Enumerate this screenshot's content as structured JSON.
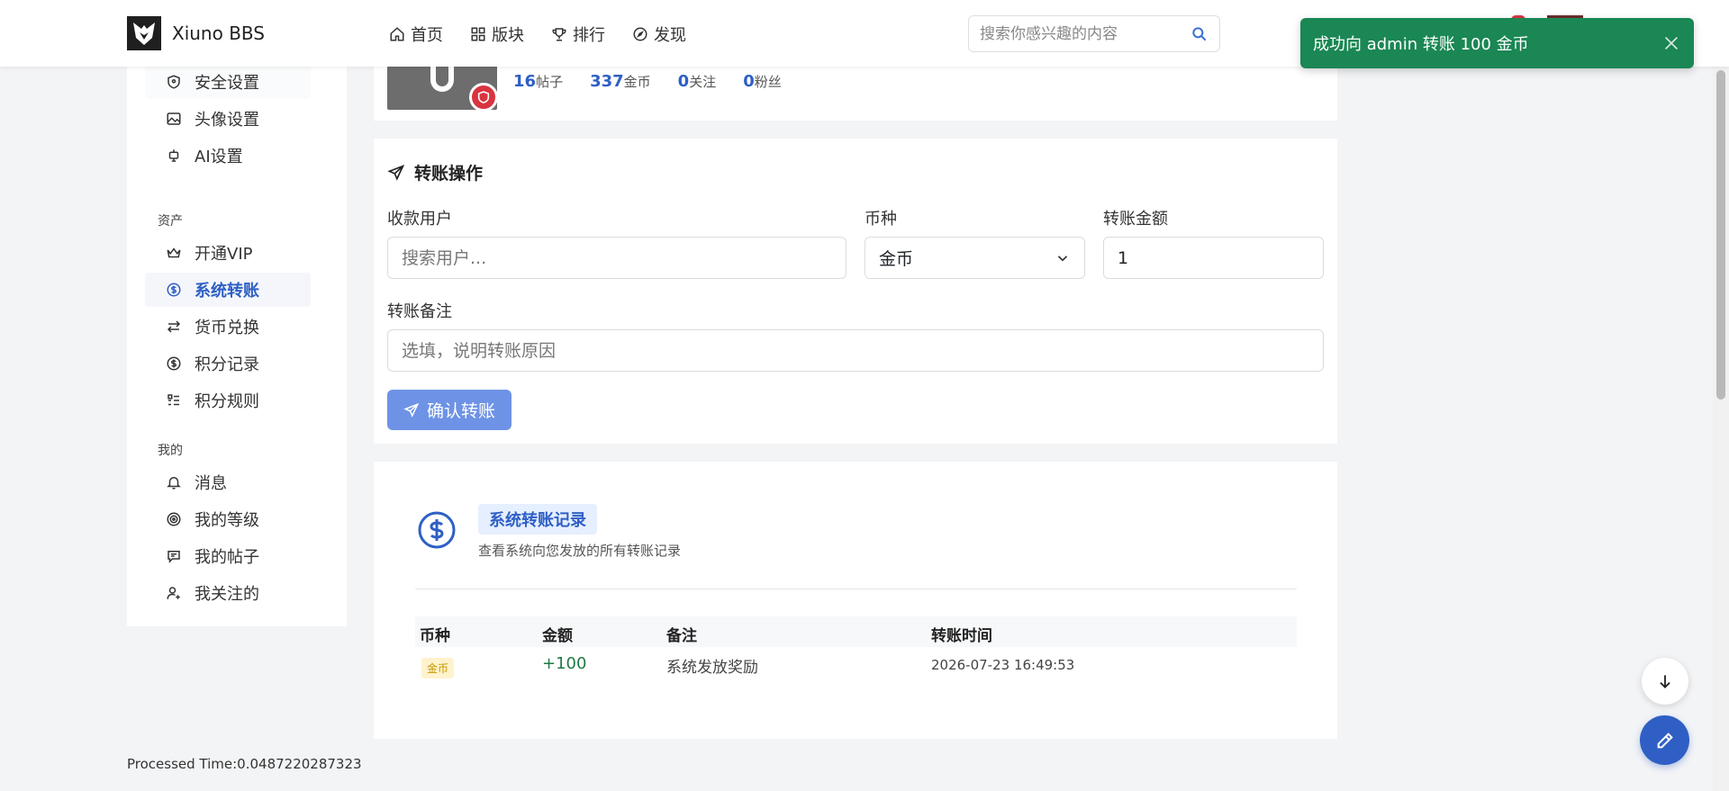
{
  "header": {
    "brand": "Xiuno BBS",
    "nav": [
      {
        "label": "首页",
        "icon": "home-icon"
      },
      {
        "label": "版块",
        "icon": "grid-icon"
      },
      {
        "label": "排行",
        "icon": "trophy-icon"
      },
      {
        "label": "发现",
        "icon": "compass-icon"
      }
    ],
    "search_placeholder": "搜索你感兴趣的内容"
  },
  "toast": {
    "message": "成功向 admin 转账 100 金币",
    "color": "#1a8754"
  },
  "sidebar": {
    "items_top": [
      {
        "label": "安全设置",
        "icon": "shield-icon"
      },
      {
        "label": "头像设置",
        "icon": "image-icon"
      },
      {
        "label": "AI设置",
        "icon": "robot-icon"
      }
    ],
    "section_assets": "资产",
    "items_assets": [
      {
        "label": "开通VIP",
        "icon": "crown-icon"
      },
      {
        "label": "系统转账",
        "icon": "dollar-icon",
        "active": true
      },
      {
        "label": "货币兑换",
        "icon": "exchange-icon"
      },
      {
        "label": "积分记录",
        "icon": "dollar-icon"
      },
      {
        "label": "积分规则",
        "icon": "list-icon"
      }
    ],
    "section_mine": "我的",
    "items_mine": [
      {
        "label": "消息",
        "icon": "bell-icon"
      },
      {
        "label": "我的等级",
        "icon": "target-icon"
      },
      {
        "label": "我的帖子",
        "icon": "message-icon"
      },
      {
        "label": "我关注的",
        "icon": "user-plus-icon"
      }
    ]
  },
  "profile": {
    "stats": [
      {
        "num": "16",
        "label": "帖子"
      },
      {
        "num": "337",
        "label": "金币"
      },
      {
        "num": "0",
        "label": "关注"
      },
      {
        "num": "0",
        "label": "粉丝"
      }
    ]
  },
  "transfer": {
    "title": "转账操作",
    "recipient_label": "收款用户",
    "recipient_placeholder": "搜索用户...",
    "currency_label": "币种",
    "currency_value": "金币",
    "amount_label": "转账金额",
    "amount_value": "1",
    "note_label": "转账备注",
    "note_placeholder": "选填，说明转账原因",
    "confirm_label": "确认转账"
  },
  "records": {
    "title": "系统转账记录",
    "subtitle": "查看系统向您发放的所有转账记录",
    "columns": [
      "币种",
      "金额",
      "备注",
      "转账时间"
    ],
    "rows": [
      {
        "currency": "金币",
        "amount": "+100",
        "note": "系统发放奖励",
        "time": "2026-07-23 16:49:53"
      }
    ]
  },
  "footer": {
    "processed_time": "Processed Time:0.0487220287323"
  }
}
